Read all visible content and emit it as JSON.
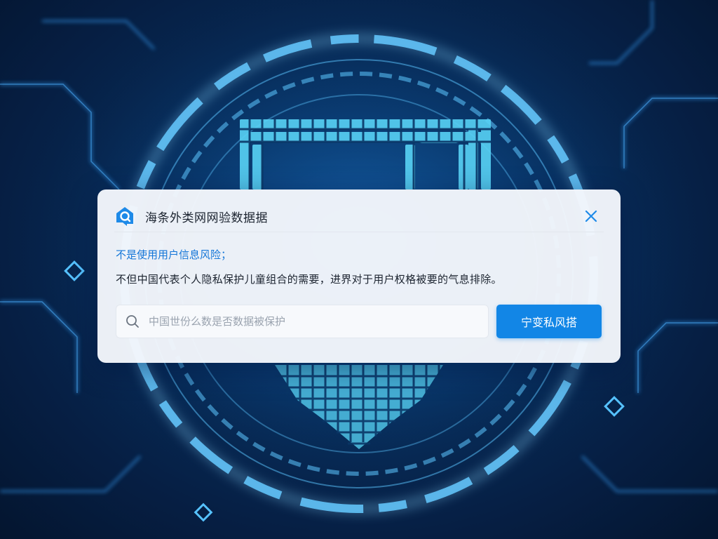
{
  "dialog": {
    "title": "海条外类网网验数据据",
    "subtitle": "不是使用用户信息风险；",
    "description": "不但中国代表个人隐私保护儿童组合的需要，进界对于用户权格被要的气息排除。",
    "search": {
      "placeholder": "中国世份么数是否数据被保护"
    },
    "action_button_label": "宁变私风搭"
  },
  "icons": {
    "app": "house-shield-icon",
    "close": "close-icon",
    "search": "search-icon",
    "background": "shield-lock-icon"
  },
  "colors": {
    "accent": "#1286e6",
    "subtitle": "#1476d8",
    "background_dark": "#061f44",
    "glow": "#4fc3ff"
  }
}
